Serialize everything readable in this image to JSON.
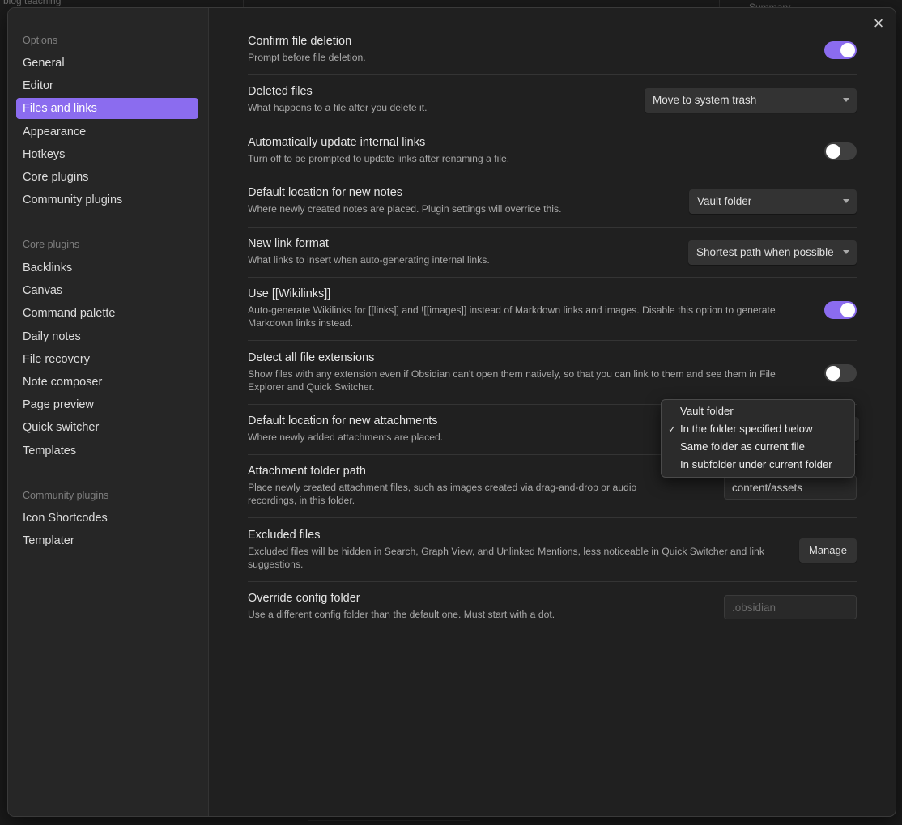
{
  "background": {
    "top_left_text": "blog  teaching",
    "right_text": "Summary"
  },
  "sidebar": {
    "options_heading": "Options",
    "options_items": [
      {
        "label": "General"
      },
      {
        "label": "Editor"
      },
      {
        "label": "Files and links",
        "active": true
      },
      {
        "label": "Appearance"
      },
      {
        "label": "Hotkeys"
      },
      {
        "label": "Core plugins"
      },
      {
        "label": "Community plugins"
      }
    ],
    "core_heading": "Core plugins",
    "core_items": [
      {
        "label": "Backlinks"
      },
      {
        "label": "Canvas"
      },
      {
        "label": "Command palette"
      },
      {
        "label": "Daily notes"
      },
      {
        "label": "File recovery"
      },
      {
        "label": "Note composer"
      },
      {
        "label": "Page preview"
      },
      {
        "label": "Quick switcher"
      },
      {
        "label": "Templates"
      }
    ],
    "community_heading": "Community plugins",
    "community_items": [
      {
        "label": "Icon Shortcodes"
      },
      {
        "label": "Templater"
      }
    ]
  },
  "close_icon": "close-icon",
  "settings": {
    "confirm_deletion": {
      "title": "Confirm file deletion",
      "desc": "Prompt before file deletion.",
      "enabled": true
    },
    "deleted_files": {
      "title": "Deleted files",
      "desc": "What happens to a file after you delete it.",
      "value": "Move to system trash"
    },
    "auto_update_links": {
      "title": "Automatically update internal links",
      "desc": "Turn off to be prompted to update links after renaming a file.",
      "enabled": false
    },
    "default_location_notes": {
      "title": "Default location for new notes",
      "desc": "Where newly created notes are placed. Plugin settings will override this.",
      "value": "Vault folder"
    },
    "new_link_format": {
      "title": "New link format",
      "desc": "What links to insert when auto-generating internal links.",
      "value": "Shortest path when possible"
    },
    "wikilinks": {
      "title": "Use [[Wikilinks]]",
      "desc": "Auto-generate Wikilinks for [[links]] and ![[images]] instead of Markdown links and images. Disable this option to generate Markdown links instead.",
      "enabled": true
    },
    "detect_extensions": {
      "title": "Detect all file extensions",
      "desc": "Show files with any extension even if Obsidian can't open them natively, so that you can link to them and see them in File Explorer and Quick Switcher.",
      "enabled": false
    },
    "default_location_attachments": {
      "title": "Default location for new attachments",
      "desc": "Where newly added attachments are placed."
    },
    "attachment_folder": {
      "title": "Attachment folder path",
      "desc": "Place newly created attachment files, such as images created via drag-and-drop or audio recordings, in this folder.",
      "value": "content/assets"
    },
    "excluded_files": {
      "title": "Excluded files",
      "desc": "Excluded files will be hidden in Search, Graph View, and Unlinked Mentions, less noticeable in Quick Switcher and link suggestions.",
      "button_label": "Manage"
    },
    "override_config": {
      "title": "Override config folder",
      "desc": "Use a different config folder than the default one. Must start with a dot.",
      "placeholder": ".obsidian"
    }
  },
  "attachment_menu": {
    "options": [
      {
        "label": "Vault folder",
        "checked": false
      },
      {
        "label": "In the folder specified below",
        "checked": true
      },
      {
        "label": "Same folder as current file",
        "checked": false
      },
      {
        "label": "In subfolder under current folder",
        "checked": false
      }
    ],
    "check_glyph": "✓"
  },
  "colors": {
    "accent": "#8b6cef",
    "background": "#202020",
    "sidebar": "#262626"
  }
}
